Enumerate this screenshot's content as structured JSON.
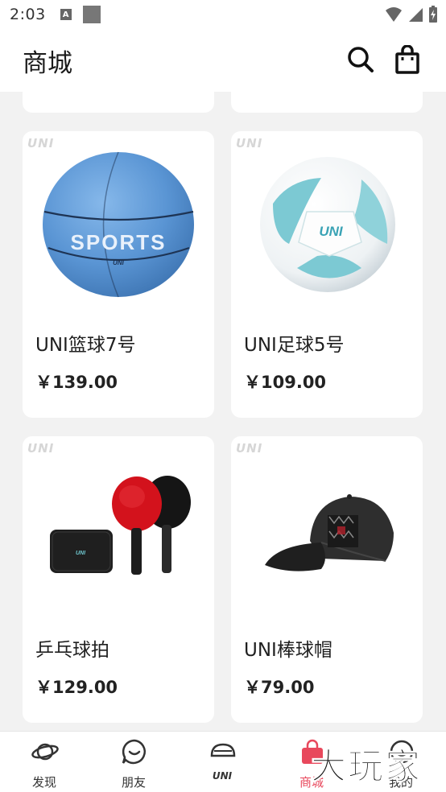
{
  "status_bar": {
    "time": "2:03",
    "a_badge": "A"
  },
  "header": {
    "title": "商城"
  },
  "brand_mark": "UNI",
  "products": [
    {
      "name": "UNI篮球7号",
      "price": "￥139.00",
      "image": "basketball"
    },
    {
      "name": "UNI足球5号",
      "price": "￥109.00",
      "image": "soccer-ball"
    },
    {
      "name": "乒乓球拍",
      "price": "￥129.00",
      "image": "ping-pong-paddles"
    },
    {
      "name": "UNI棒球帽",
      "price": "￥79.00",
      "image": "baseball-cap"
    }
  ],
  "basketball_text": "SPORTS",
  "tabs": [
    {
      "label": "发现",
      "icon": "planet-icon"
    },
    {
      "label": "朋友",
      "icon": "chat-icon"
    },
    {
      "label": "",
      "icon": "uni-car-icon",
      "logo_text": "UNI"
    },
    {
      "label": "商城",
      "icon": "shopping-bag-icon",
      "active": true
    },
    {
      "label": "我的",
      "icon": "profile-icon"
    }
  ],
  "watermark": "大玩家",
  "colors": {
    "accent": "#e8485c",
    "background": "#f2f2f2",
    "card": "#ffffff"
  }
}
